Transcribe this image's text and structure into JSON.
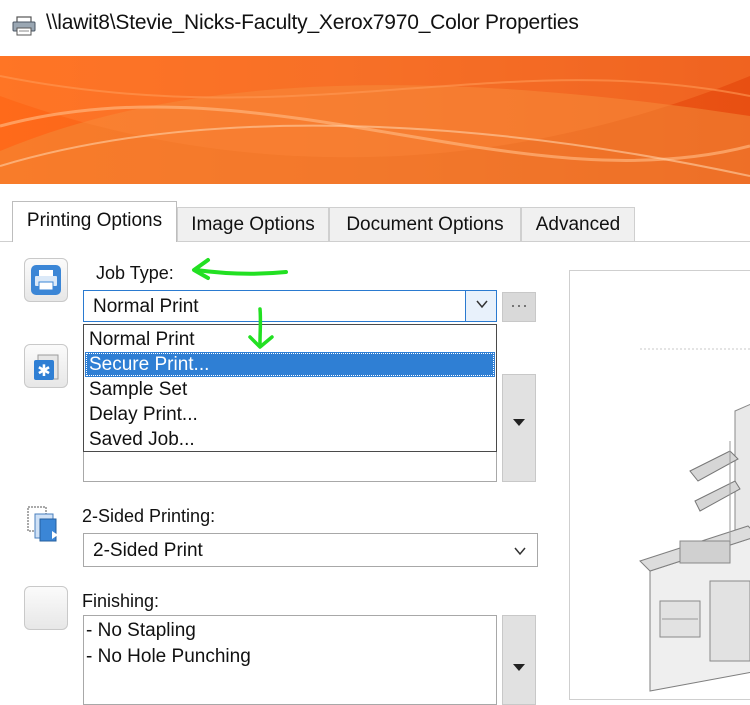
{
  "window": {
    "title": "\\\\lawit8\\Stevie_Nicks-Faculty_Xerox7970_Color Properties"
  },
  "tabs": [
    {
      "label": "Printing Options",
      "active": true
    },
    {
      "label": "Image Options",
      "active": false
    },
    {
      "label": "Document Options",
      "active": false
    },
    {
      "label": "Advanced",
      "active": false
    }
  ],
  "job_type": {
    "label": "Job Type:",
    "value": "Normal Print",
    "more_button": "···",
    "options": [
      {
        "label": "Normal Print",
        "selected": false
      },
      {
        "label": "Secure Print...",
        "selected": true
      },
      {
        "label": "Sample Set",
        "selected": false
      },
      {
        "label": "Delay Print...",
        "selected": false
      },
      {
        "label": "Saved Job...",
        "selected": false
      }
    ]
  },
  "two_sided": {
    "label": "2-Sided Printing:",
    "value": "2-Sided Print"
  },
  "finishing": {
    "label": "Finishing:",
    "lines": [
      "- No Stapling",
      "- No Hole Punching"
    ]
  },
  "colors": {
    "accent_blue": "#2f7fd4",
    "banner_orange": "#f26b1d",
    "annotation_green": "#22e022"
  },
  "icons": {
    "title": "printer-icon",
    "job_type": "printer-icon",
    "second": "star-document-icon",
    "two_sided": "duplex-pages-icon",
    "finishing": "finishing-icon"
  }
}
